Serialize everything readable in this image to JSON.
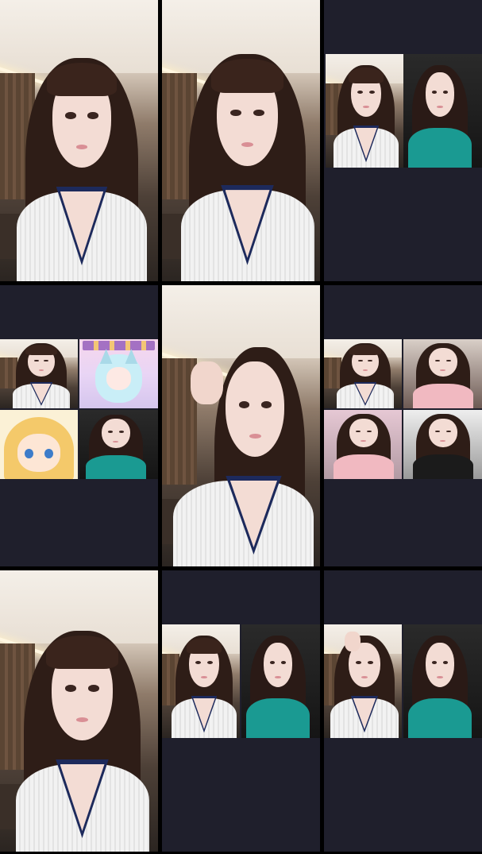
{
  "screen": {
    "background": "#000000",
    "empty_area_color": "#1f1f2c"
  },
  "tiles": [
    {
      "name": "tile-1",
      "layout": "single",
      "feeds": [
        "woman-white-sweater"
      ]
    },
    {
      "name": "tile-2",
      "layout": "single",
      "feeds": [
        "woman-white-sweater"
      ]
    },
    {
      "name": "tile-3",
      "layout": "pair",
      "feeds": [
        "woman-white-sweater",
        "woman-teal-top"
      ]
    },
    {
      "name": "tile-4",
      "layout": "quad",
      "feeds": [
        "woman-white-sweater",
        "vtuber-avatar",
        "anime-avatar",
        "woman-teal-top"
      ]
    },
    {
      "name": "tile-5",
      "layout": "single",
      "feeds": [
        "woman-white-sweater-hand-raised"
      ]
    },
    {
      "name": "tile-6",
      "layout": "quad",
      "feeds": [
        "woman-white-sweater",
        "woman-pink-top",
        "woman-pink-top",
        "woman-dark-top"
      ]
    },
    {
      "name": "tile-7",
      "layout": "single",
      "feeds": [
        "woman-white-sweater"
      ]
    },
    {
      "name": "tile-8",
      "layout": "pair",
      "feeds": [
        "woman-white-sweater",
        "woman-teal-top"
      ]
    },
    {
      "name": "tile-9",
      "layout": "pair",
      "feeds": [
        "woman-white-sweater-hand-raised",
        "woman-teal-top"
      ]
    }
  ]
}
